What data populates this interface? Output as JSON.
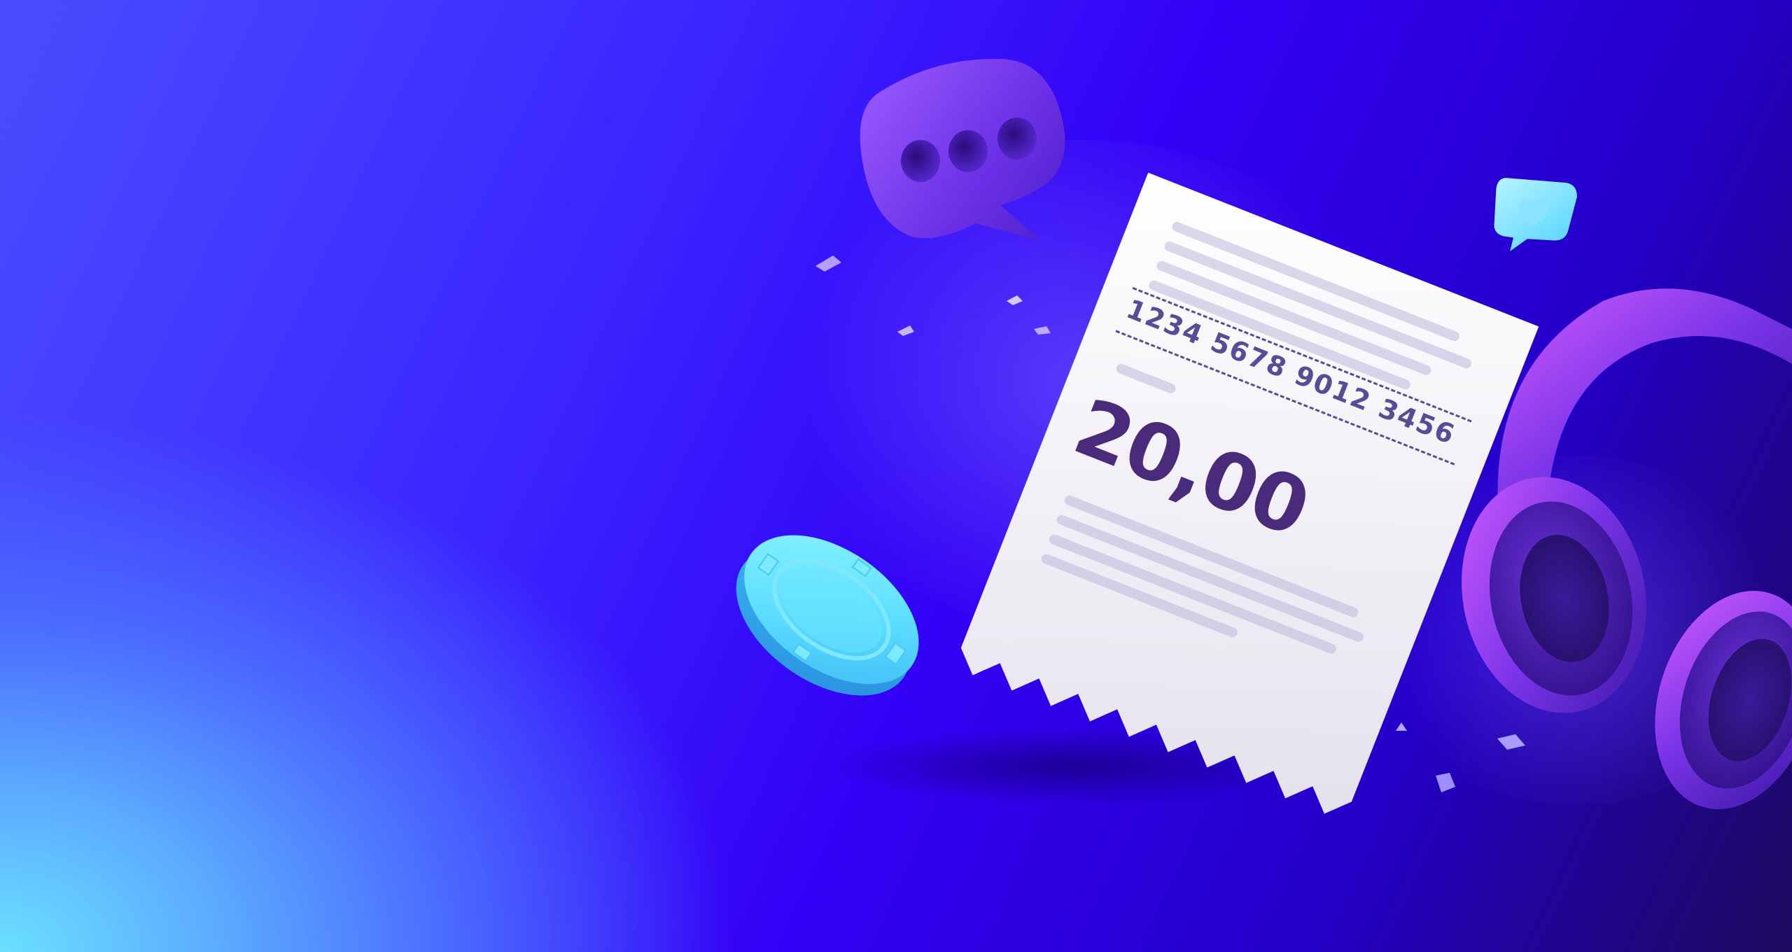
{
  "scene": {
    "receipt": {
      "card_number": "1234  5678  9012  3456",
      "amount": "20,00"
    },
    "icons": [
      "chat-bubble-icon",
      "heart-message-icon",
      "poker-chip-icon",
      "headphones-icon"
    ],
    "colors": {
      "background_start": "#6be0ff",
      "background_mid": "#3300f5",
      "background_end": "#1d0a5c",
      "chat_bubble": "#7a3cf0",
      "chip": "#5fe6ff",
      "headphones": "#8a3cff",
      "receipt_text": "#4a2a7a"
    }
  }
}
